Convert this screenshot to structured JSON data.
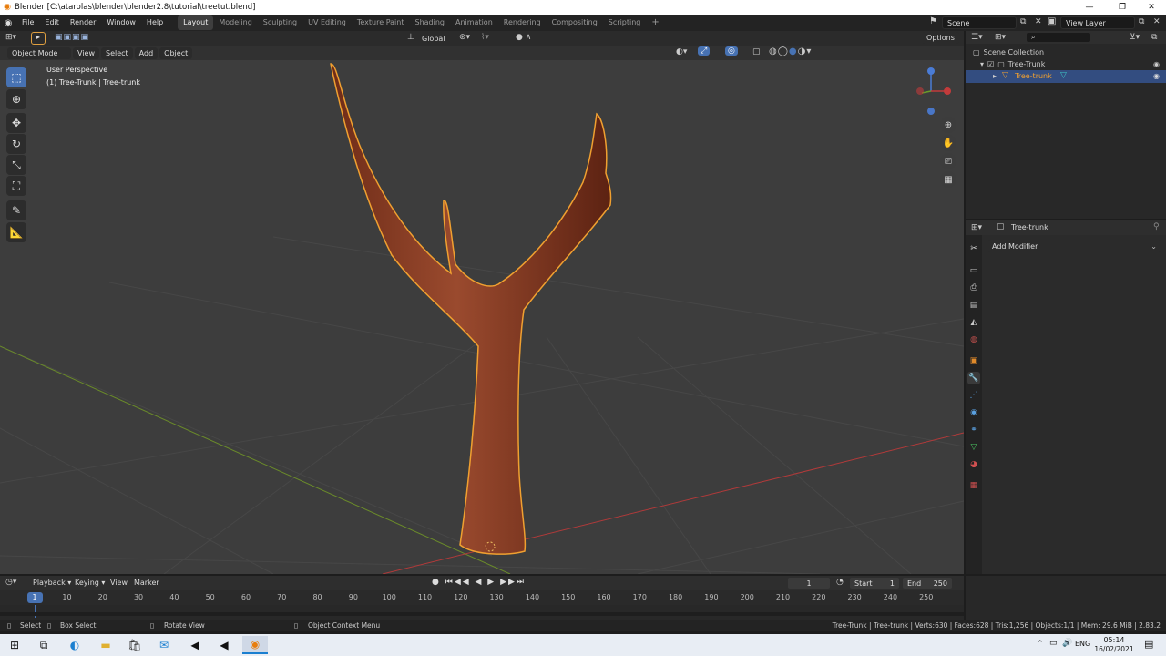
{
  "window": {
    "title": "Blender [C:\\atarolas\\blender\\blender2.8\\tutorial\\treetut.blend]",
    "minimize": "—",
    "maximize": "❐",
    "close": "✕"
  },
  "menu": [
    "File",
    "Edit",
    "Render",
    "Window",
    "Help"
  ],
  "workspaces": [
    "Layout",
    "Modeling",
    "Sculpting",
    "UV Editing",
    "Texture Paint",
    "Shading",
    "Animation",
    "Rendering",
    "Compositing",
    "Scripting"
  ],
  "active_workspace": "Layout",
  "scene": {
    "label": "Scene",
    "view_layer": "View Layer"
  },
  "viewport_toolbar": {
    "transform_orientation": "Global",
    "options": "Options"
  },
  "viewport_header": {
    "mode": "Object Mode",
    "menus": [
      "View",
      "Select",
      "Add",
      "Object"
    ]
  },
  "viewport_info": {
    "perspective": "User Perspective",
    "object": "(1) Tree-Trunk | Tree-trunk"
  },
  "gizmo": {
    "x": "X",
    "y": "Y",
    "z": "Z"
  },
  "outliner": {
    "root": "Scene Collection",
    "collection": "Tree-Trunk",
    "object": "Tree-trunk"
  },
  "properties": {
    "object_name": "Tree-trunk",
    "add_modifier": "Add Modifier"
  },
  "timeline": {
    "menus": [
      "Playback",
      "Keying",
      "View",
      "Marker"
    ],
    "current_frame": "1",
    "start_label": "Start",
    "start": "1",
    "end_label": "End",
    "end": "250",
    "ruler": [
      "1",
      "10",
      "20",
      "30",
      "40",
      "50",
      "60",
      "70",
      "80",
      "90",
      "100",
      "110",
      "120",
      "130",
      "140",
      "150",
      "160",
      "170",
      "180",
      "190",
      "200",
      "210",
      "220",
      "230",
      "240",
      "250"
    ]
  },
  "statusbar": {
    "select": "Select",
    "box_select": "Box Select",
    "rotate_view": "Rotate View",
    "context_menu": "Object Context Menu",
    "stats": "Tree-Trunk | Tree-trunk | Verts:630 | Faces:628 | Tris:1,256 | Objects:1/1 | Mem: 29.6 MiB | 2.83.2"
  },
  "taskbar": {
    "lang": "ENG",
    "time": "05:14",
    "date": "16/02/2021"
  },
  "colors": {
    "accent": "#4772b3",
    "selection": "#f0a030",
    "tree": "#8a3c24",
    "x_axis": "#c23b3b",
    "y_axis": "#6a8a2a"
  }
}
